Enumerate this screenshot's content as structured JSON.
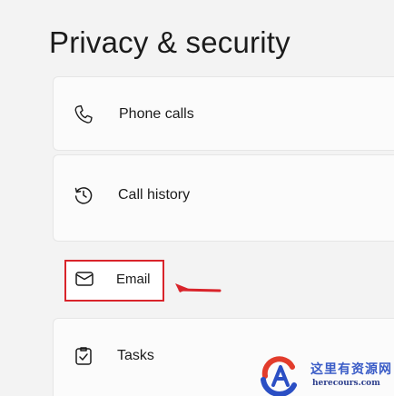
{
  "page": {
    "title": "Privacy & security"
  },
  "items": {
    "phone_calls": {
      "label": "Phone calls",
      "icon": "phone-icon"
    },
    "call_history": {
      "label": "Call history",
      "icon": "history-icon"
    },
    "email": {
      "label": "Email",
      "icon": "mail-icon"
    },
    "tasks": {
      "label": "Tasks",
      "icon": "tasks-icon"
    }
  },
  "annotation": {
    "highlight_color": "#d9242b"
  },
  "watermark": {
    "title": "这里有资源网",
    "url": "herecours.com"
  }
}
